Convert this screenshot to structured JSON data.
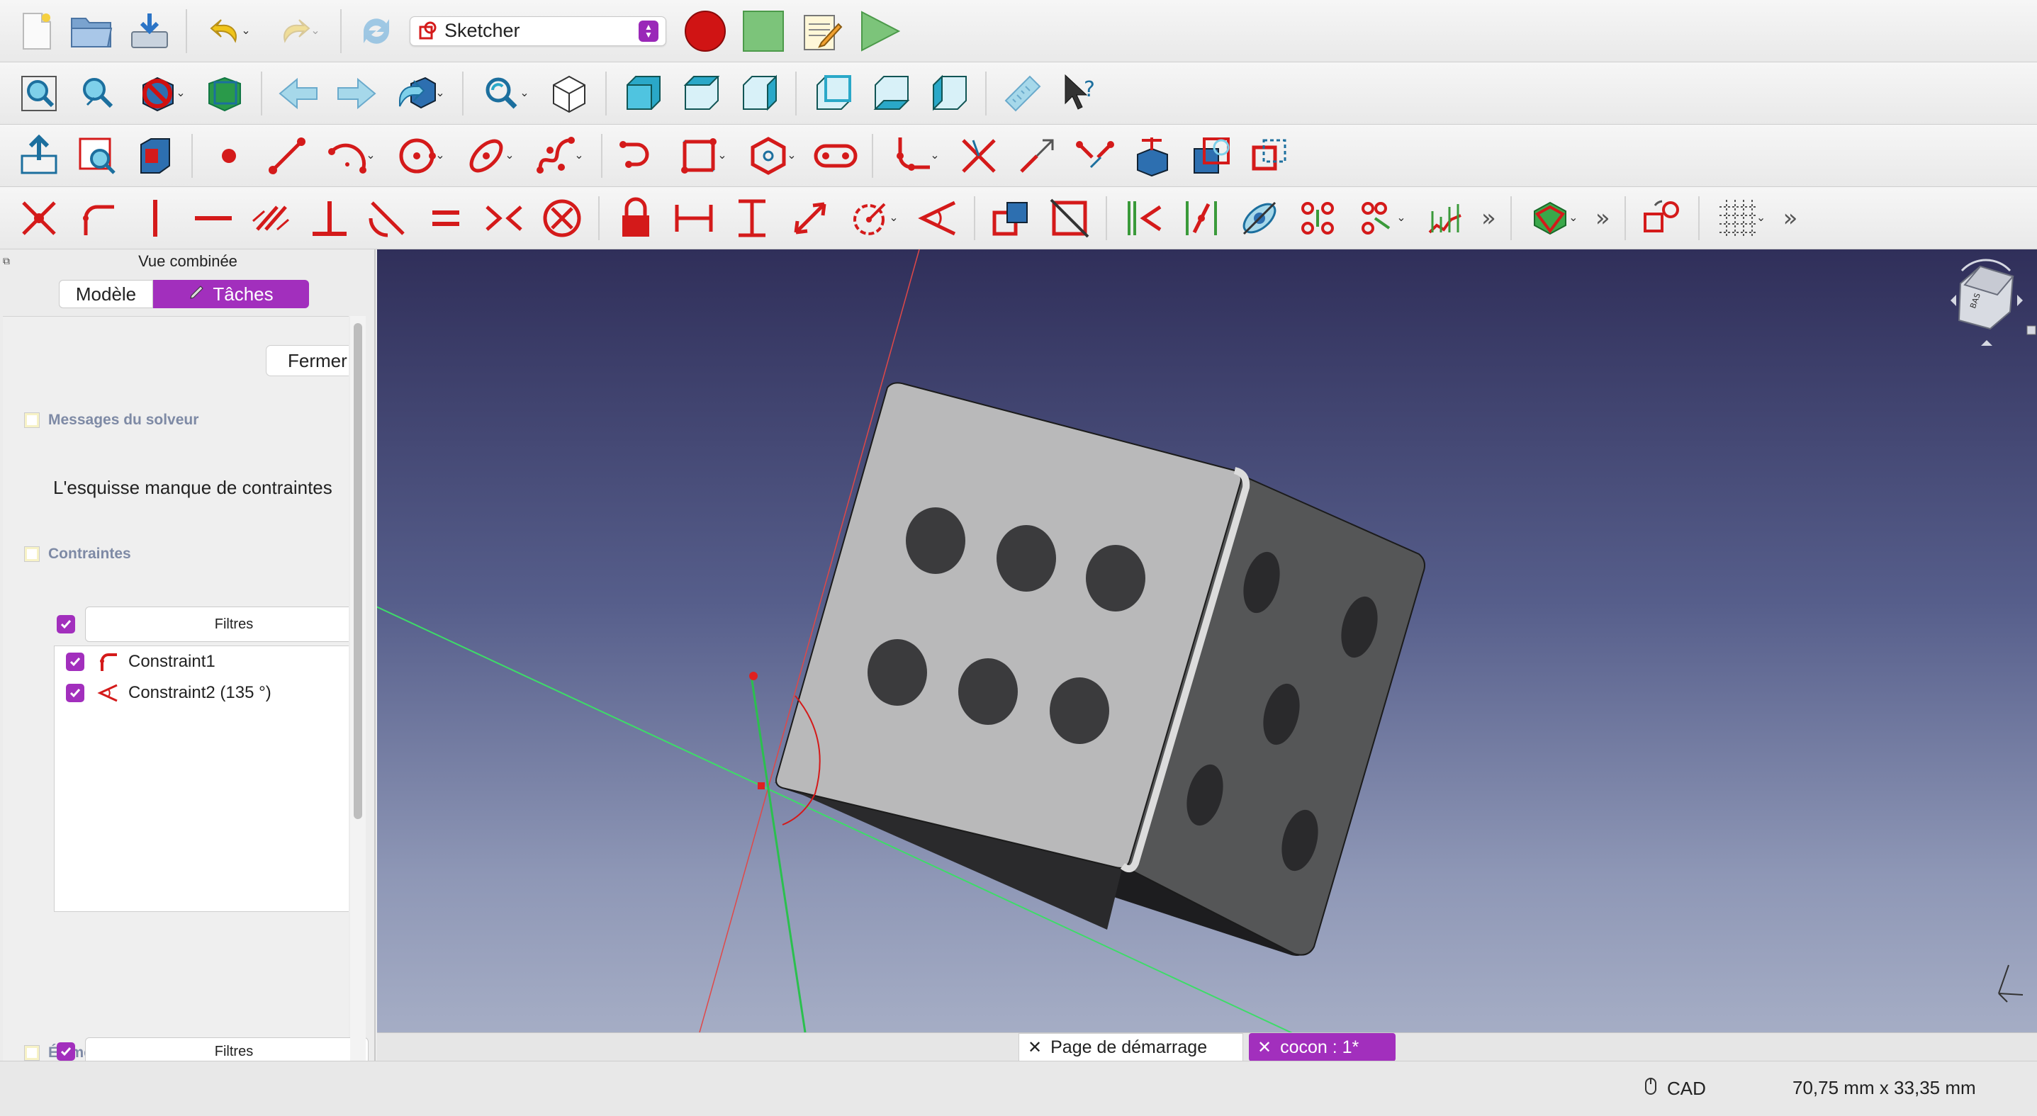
{
  "toolbar_file": {
    "workbench": "Sketcher",
    "buttons": [
      "new-document-icon",
      "open-icon",
      "save-icon",
      "undo-icon",
      "redo-icon",
      "refresh-icon",
      "record-macro-icon",
      "stop-macro-icon",
      "edit-macro-icon",
      "run-macro-icon"
    ]
  },
  "left_panel": {
    "title": "Vue combinée",
    "tabs": {
      "model": "Modèle",
      "tasks": "Tâches"
    },
    "close_label": "Fermer",
    "solver_section": "Messages du solveur",
    "solver_message": "L'esquisse manque de contraintes",
    "constraints_section": "Contraintes",
    "filters_label": "Filtres",
    "constraints": [
      {
        "name": "Constraint1",
        "icon": "tangent-constraint-icon",
        "checked": true
      },
      {
        "name": "Constraint2 (135 °)",
        "icon": "angle-constraint-icon",
        "checked": true
      }
    ],
    "elements_section": "Éléments",
    "elements_filters_label": "Filtres"
  },
  "navigation_cube": {
    "face_label": "BAS"
  },
  "document_tabs": [
    {
      "label": "Page de démarrage",
      "active": false
    },
    {
      "label": "cocon : 1*",
      "active": true
    }
  ],
  "status": {
    "navigation_style": "CAD",
    "dimensions": "70,75 mm x 33,35 mm"
  },
  "colors": {
    "accent": "#a22fbd",
    "sketch_red": "#d41a1a",
    "view_blue": "#2aa8c8",
    "viewport_top": "#302f5a",
    "viewport_bottom": "#a5adc5"
  }
}
